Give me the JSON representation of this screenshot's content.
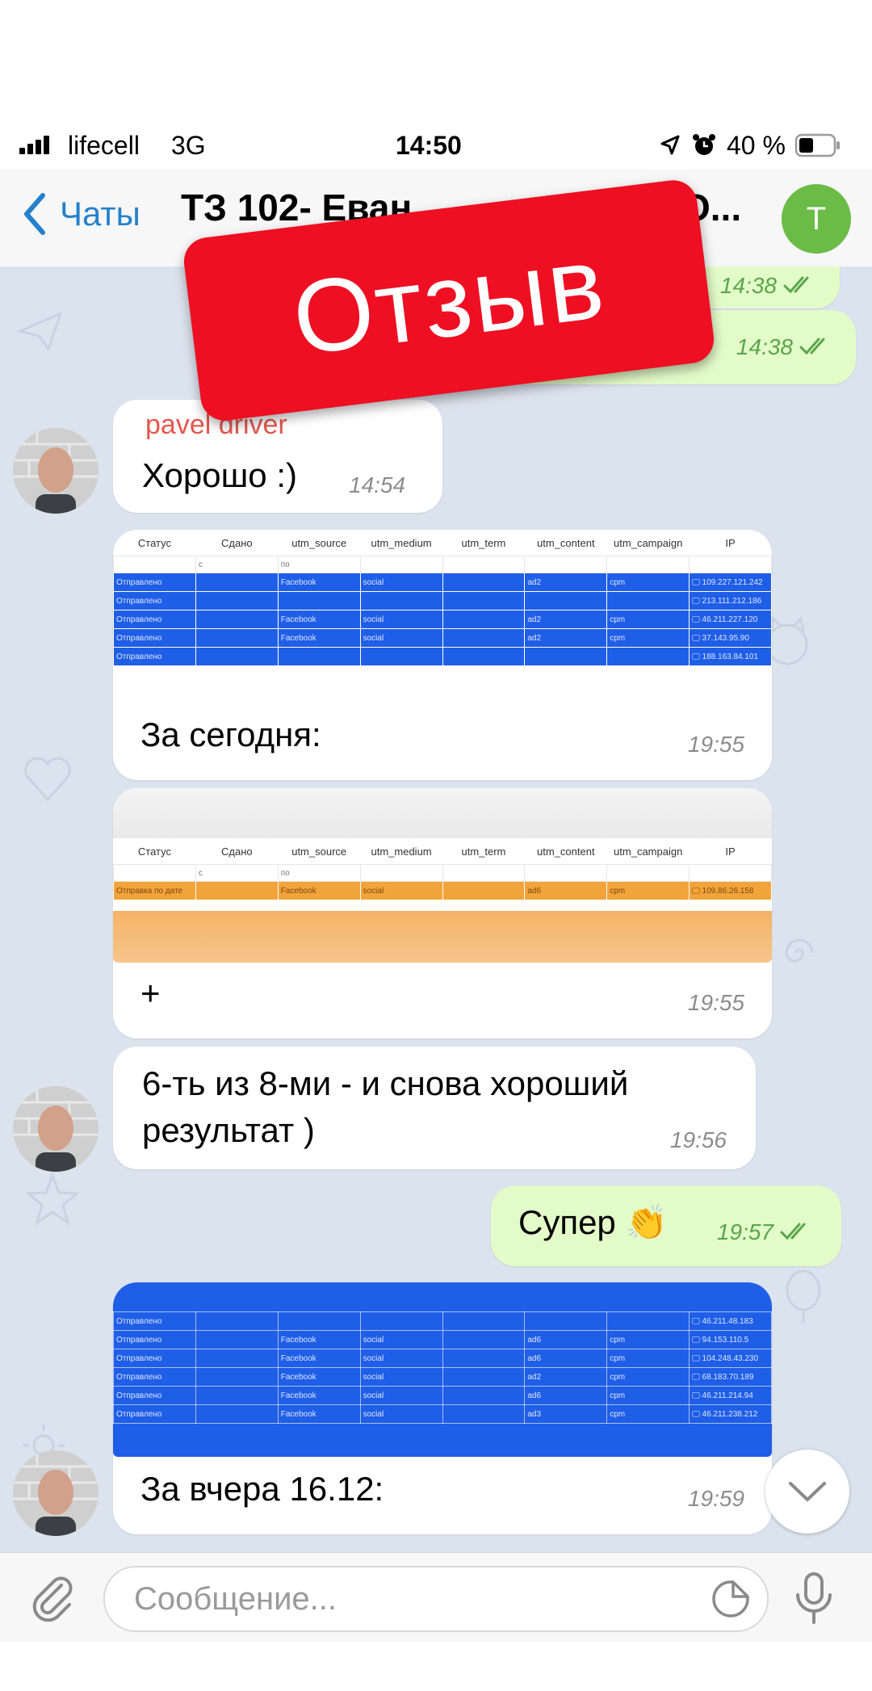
{
  "status_bar": {
    "carrier": "lifecell",
    "network": "3G",
    "time": "14:50",
    "battery": "40 %"
  },
  "nav": {
    "back_label": "Чаты",
    "title": "ТЗ 102- Еван",
    "title_suffix": "О...",
    "avatar_letter": "T"
  },
  "stamp": {
    "text": "Отзыв"
  },
  "messages": {
    "top_out_1_time": "14:38",
    "top_out_2_end": ")",
    "top_out_2_time": "14:38",
    "m1_sender": "pavel driver",
    "m1_text": "Хорошо :)",
    "m1_time": "14:54",
    "m2_caption": "За сегодня:",
    "m2_time": "19:55",
    "m3_caption": "+",
    "m3_time": "19:55",
    "m4_line1": "6-ть из 8-ми - и снова хороший",
    "m4_line2": "результат )",
    "m4_time": "19:56",
    "m5_text": "Супер 👏",
    "m5_time": "19:57",
    "m6_caption": "За вчера 16.12:",
    "m6_time": "19:59"
  },
  "table1": {
    "headers": [
      "Статус",
      "Сдано",
      "utm_source",
      "utm_medium",
      "utm_term",
      "utm_content",
      "utm_campaign",
      "IP"
    ],
    "filter": [
      "",
      "с",
      "по",
      "",
      "",
      "",
      "",
      ""
    ],
    "rows": [
      [
        "Отправлено",
        "",
        "Facebook",
        "social",
        "",
        "ad2",
        "cpm",
        "🖵 109.227.121.242"
      ],
      [
        "Отправлено",
        "",
        "",
        "",
        "",
        "",
        "",
        "🖵 213.111.212.186"
      ],
      [
        "Отправлено",
        "",
        "Facebook",
        "social",
        "",
        "ad2",
        "cpm",
        "🖵 46.211.227.120"
      ],
      [
        "Отправлено",
        "",
        "Facebook",
        "social",
        "",
        "ad2",
        "cpm",
        "🖵 37.143.95.90"
      ],
      [
        "Отправлено",
        "",
        "",
        "",
        "",
        "",
        "",
        "🖵 188.163.84.101"
      ]
    ]
  },
  "table2": {
    "headers": [
      "Статус",
      "Сдано",
      "utm_source",
      "utm_medium",
      "utm_term",
      "utm_content",
      "utm_campaign",
      "IP"
    ],
    "filter": [
      "",
      "с",
      "по",
      "",
      "",
      "",
      "",
      ""
    ],
    "rows": [
      [
        "Отправка по дате",
        "",
        "Facebook",
        "social",
        "",
        "ad6",
        "cpm",
        "🖵 109.86.26.158"
      ]
    ]
  },
  "table3": {
    "rows": [
      [
        "Отправлено",
        "",
        "",
        "",
        "",
        "",
        "",
        "🖵 46.211.48.183"
      ],
      [
        "Отправлено",
        "",
        "Facebook",
        "social",
        "",
        "ad6",
        "cpm",
        "🖵 94.153.110.5"
      ],
      [
        "Отправлено",
        "",
        "Facebook",
        "social",
        "",
        "ad6",
        "cpm",
        "🖵 104.248.43.230"
      ],
      [
        "Отправлено",
        "",
        "Facebook",
        "social",
        "",
        "ad2",
        "cpm",
        "🖵 68.183.70.189"
      ],
      [
        "Отправлено",
        "",
        "Facebook",
        "social",
        "",
        "ad6",
        "cpm",
        "🖵 46.211.214.94"
      ],
      [
        "Отправлено",
        "",
        "Facebook",
        "social",
        "",
        "ad3",
        "cpm",
        "🖵 46.211.238.212"
      ]
    ]
  },
  "input": {
    "placeholder": "Сообщение..."
  },
  "colors": {
    "accent": "#2481cc",
    "outgoing_bubble": "#e3fbc9",
    "stamp": "#ee0f22",
    "table_blue": "#1f5ee6",
    "table_orange": "#f2a33a"
  },
  "icons": [
    "signal-icon",
    "location-arrow-icon",
    "alarm-icon",
    "battery-icon",
    "back-chevron-icon",
    "attach-icon",
    "sticker-icon",
    "microphone-icon",
    "chevron-down-icon",
    "double-check-icon"
  ]
}
